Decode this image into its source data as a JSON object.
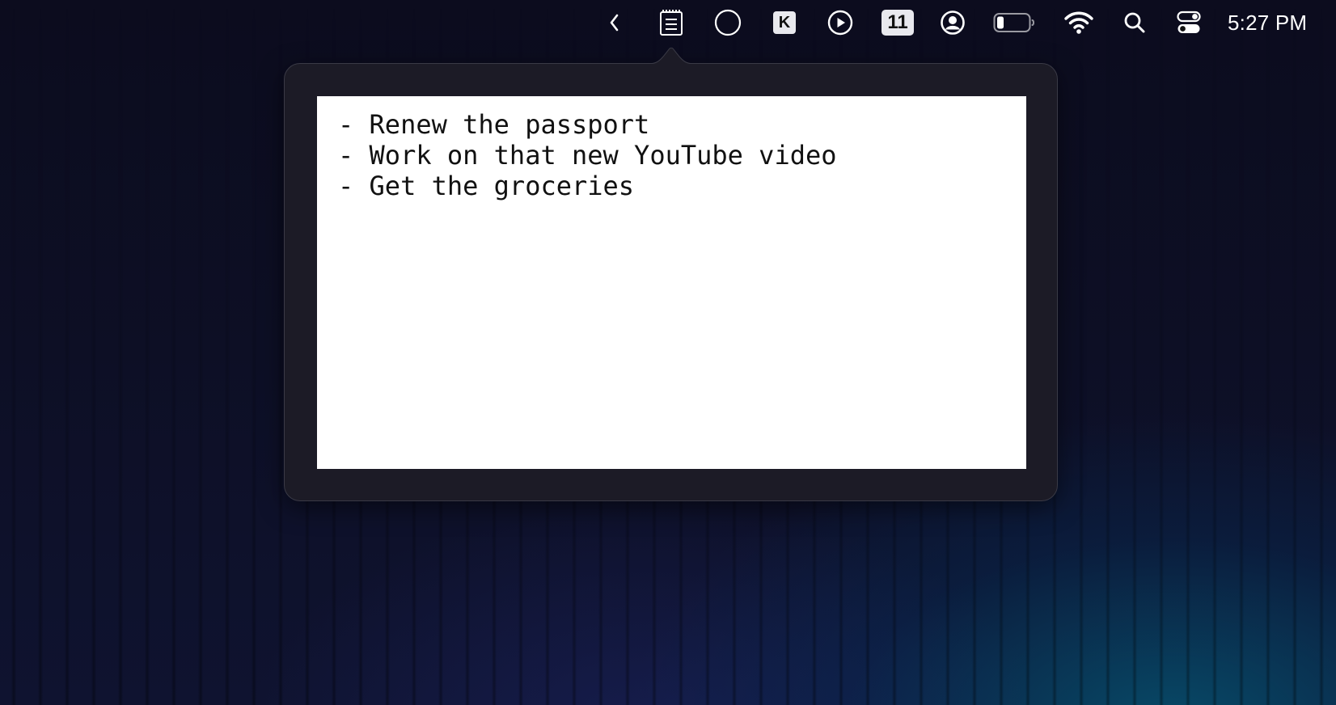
{
  "menubar": {
    "clock": "5:27 PM",
    "calendar_badge": "11",
    "k_badge": "K",
    "icons": {
      "chevron": "chevron-left-icon",
      "notepad": "notepad-icon",
      "circle": "circle-icon",
      "k_app": "k-app-icon",
      "play": "play-icon",
      "calendar": "calendar-icon",
      "user": "user-icon",
      "battery": "battery-icon",
      "wifi": "wifi-icon",
      "search": "search-icon",
      "control_center": "control-center-icon"
    }
  },
  "note": {
    "lines": [
      "- Renew the passport",
      "- Work on that new YouTube video",
      "- Get the groceries"
    ]
  },
  "colors": {
    "popover_bg": "#1c1b26",
    "note_bg": "#ffffff",
    "desktop_bg": "#0b0b1d"
  }
}
